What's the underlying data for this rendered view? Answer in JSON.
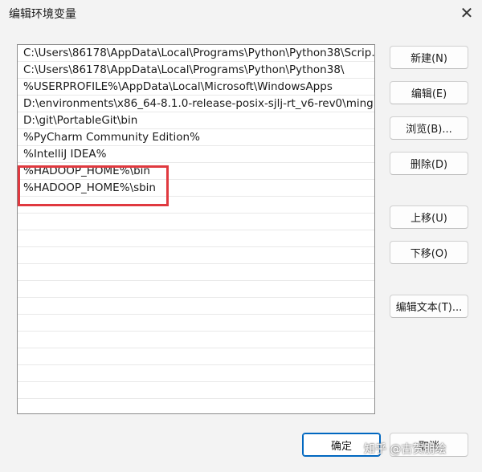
{
  "window": {
    "title": "编辑环境变量",
    "close_glyph": "✕"
  },
  "list": {
    "items": [
      "C:\\Users\\86178\\AppData\\Local\\Programs\\Python\\Python38\\Scrip...",
      "C:\\Users\\86178\\AppData\\Local\\Programs\\Python\\Python38\\",
      "%USERPROFILE%\\AppData\\Local\\Microsoft\\WindowsApps",
      "D:\\environments\\x86_64-8.1.0-release-posix-sjlj-rt_v6-rev0\\ming...",
      "D:\\git\\PortableGit\\bin",
      "%PyCharm Community Edition%",
      "%IntelliJ IDEA%",
      "%HADOOP_HOME%\\bin",
      "%HADOOP_HOME%\\sbin",
      "",
      "",
      "",
      "",
      "",
      "",
      "",
      "",
      "",
      "",
      "",
      ""
    ]
  },
  "buttons": {
    "new": "新建(N)",
    "edit": "编辑(E)",
    "browse": "浏览(B)...",
    "delete": "删除(D)",
    "move_up": "上移(U)",
    "move_down": "下移(O)",
    "edit_text": "编辑文本(T)...",
    "ok": "确定",
    "cancel": "取消"
  },
  "watermark": "知乎 @古贺朋绘",
  "colors": {
    "highlight_border": "#e0393f",
    "primary_border": "#0067c0"
  }
}
